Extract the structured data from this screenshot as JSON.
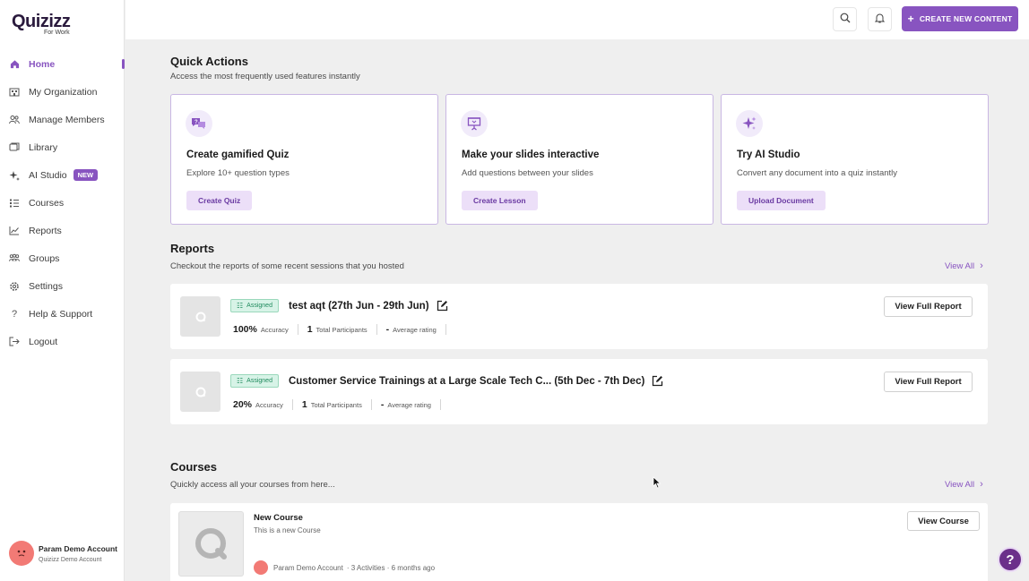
{
  "brand": {
    "name": "Quizizz",
    "tagline": "For Work"
  },
  "sidebar": {
    "items": [
      {
        "label": "Home",
        "icon": "home-icon",
        "active": true
      },
      {
        "label": "My Organization",
        "icon": "organization-icon"
      },
      {
        "label": "Manage Members",
        "icon": "members-icon"
      },
      {
        "label": "Library",
        "icon": "library-icon"
      },
      {
        "label": "AI Studio",
        "icon": "sparkle-icon",
        "badge": "NEW"
      },
      {
        "label": "Courses",
        "icon": "courses-icon"
      },
      {
        "label": "Reports",
        "icon": "reports-icon"
      },
      {
        "label": "Groups",
        "icon": "groups-icon"
      },
      {
        "label": "Settings",
        "icon": "settings-icon"
      },
      {
        "label": "Help & Support",
        "icon": "question-icon"
      },
      {
        "label": "Logout",
        "icon": "logout-icon"
      }
    ],
    "account": {
      "name": "Param Demo Account",
      "org": "Quizizz Demo Account"
    }
  },
  "topbar": {
    "create_label": "CREATE NEW CONTENT"
  },
  "quick_actions": {
    "title": "Quick Actions",
    "subtitle": "Access the most frequently used features instantly",
    "cards": [
      {
        "title": "Create gamified Quiz",
        "desc": "Explore 10+ question types",
        "button": "Create Quiz",
        "icon": "quiz-chat-icon"
      },
      {
        "title": "Make your slides interactive",
        "desc": "Add questions between your slides",
        "button": "Create Lesson",
        "icon": "presentation-icon"
      },
      {
        "title": "Try AI Studio",
        "desc": "Convert any document into a quiz instantly",
        "button": "Upload Document",
        "icon": "sparkle-icon"
      }
    ]
  },
  "reports": {
    "title": "Reports",
    "subtitle": "Checkout the reports of some recent sessions that you hosted",
    "view_all": "View All",
    "items": [
      {
        "status": "Assigned",
        "title": "test aqt (27th Jun - 29th Jun)",
        "accuracy": "100%",
        "accuracy_label": "Accuracy",
        "participants": "1",
        "participants_label": "Total Participants",
        "rating": "-",
        "rating_label": "Average rating",
        "button": "View Full Report"
      },
      {
        "status": "Assigned",
        "title": "Customer Service Trainings at a Large Scale Tech C... (5th Dec - 7th Dec)",
        "accuracy": "20%",
        "accuracy_label": "Accuracy",
        "participants": "1",
        "participants_label": "Total Participants",
        "rating": "-",
        "rating_label": "Average rating",
        "button": "View Full Report"
      }
    ]
  },
  "courses": {
    "title": "Courses",
    "subtitle": "Quickly access all your courses from here...",
    "view_all": "View All",
    "items": [
      {
        "title": "New Course",
        "desc": "This is a new Course",
        "author": "Param Demo Account",
        "meta": "· 3 Activities · 6 months ago",
        "button": "View Course"
      }
    ]
  },
  "colors": {
    "accent": "#8854c0",
    "assigned_bg": "#d7f3e7",
    "assigned_text": "#1f8a5d"
  }
}
